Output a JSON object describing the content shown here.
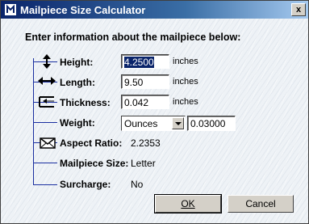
{
  "window": {
    "title": "Mailpiece Size Calculator",
    "close_glyph": "x"
  },
  "instruction": "Enter information about the mailpiece below:",
  "fields": {
    "height": {
      "label": "Height:",
      "value": "4.2500",
      "unit": "inches",
      "icon": "height-arrows-icon"
    },
    "length": {
      "label": "Length:",
      "value": "9.50",
      "unit": "inches",
      "icon": "length-arrows-icon"
    },
    "thickness": {
      "label": "Thickness:",
      "value": "0.042",
      "unit": "inches",
      "icon": "thickness-icon"
    },
    "weight": {
      "label": "Weight:",
      "unit_selected": "Ounces",
      "value": "0.03000"
    }
  },
  "results": {
    "aspect_ratio": {
      "label": "Aspect Ratio:",
      "value": "2.2353",
      "icon": "envelope-icon"
    },
    "mailpiece_size": {
      "label": "Mailpiece Size:",
      "value": "Letter"
    },
    "surcharge": {
      "label": "Surcharge:",
      "value": "No"
    }
  },
  "buttons": {
    "ok": "OK",
    "cancel": "Cancel"
  },
  "colors": {
    "title_start": "#0a246a",
    "title_end": "#a6caf0",
    "tree_line": "#1a2fa0"
  }
}
